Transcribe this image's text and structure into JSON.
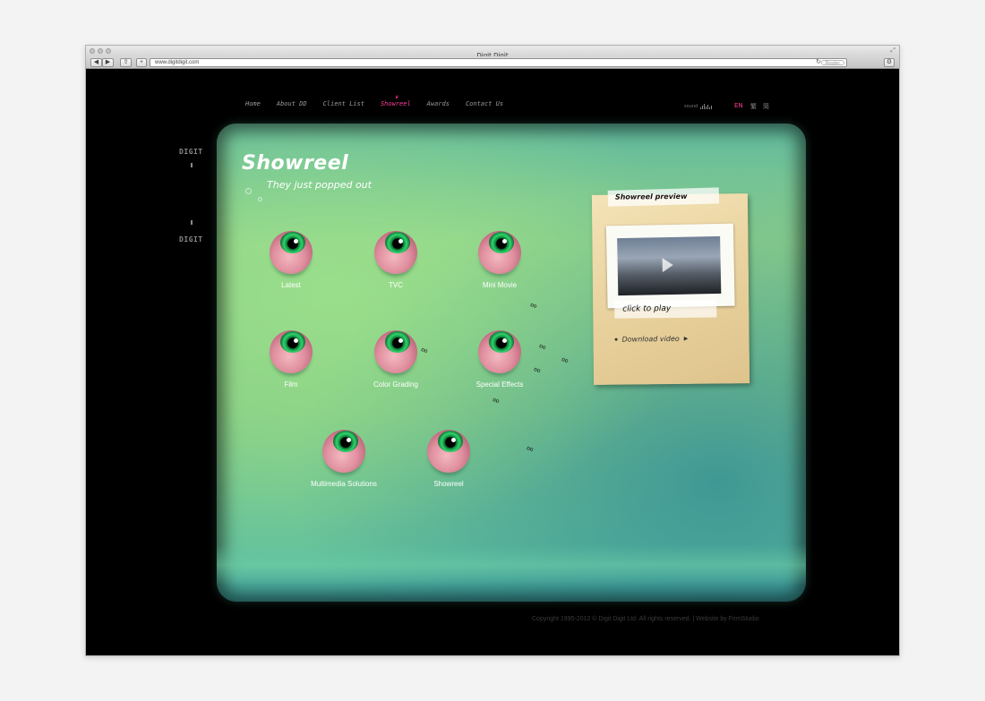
{
  "browser": {
    "title": "Digit Digit",
    "url": "www.digitdigit.com",
    "reader_label": "Reader"
  },
  "nav": {
    "items": [
      {
        "label": "Home",
        "active": false
      },
      {
        "label": "About DD",
        "active": false
      },
      {
        "label": "Client List",
        "active": false
      },
      {
        "label": "Showreel",
        "active": true
      },
      {
        "label": "Awards",
        "active": false
      },
      {
        "label": "Contact Us",
        "active": false
      }
    ],
    "sound_label": "sound",
    "languages": [
      {
        "label": "EN",
        "active": true
      },
      {
        "label": "繁",
        "active": false
      },
      {
        "label": "简",
        "active": false
      }
    ]
  },
  "side": {
    "top": "DIGIT",
    "bottom": "DIGIT"
  },
  "section": {
    "title": "Showreel",
    "subtitle": "They just popped out"
  },
  "categories": [
    {
      "label": "Latest"
    },
    {
      "label": "TVC"
    },
    {
      "label": "Mini Movie"
    },
    {
      "label": "Film"
    },
    {
      "label": "Color Grading"
    },
    {
      "label": "Special Effects"
    },
    {
      "label": "Multimedia Solutions"
    },
    {
      "label": "Showreel"
    }
  ],
  "preview": {
    "title": "Showreel preview",
    "click_label": "click to play",
    "download_label": "Download video"
  },
  "footer": {
    "copyright": "Copyright 1995-2012 © Digit Digit Ltd. All rights reserved. | Website by FirmStudio"
  },
  "colors": {
    "accent": "#ff3c9c",
    "screen_green": "#8fd18a",
    "card": "#e9d29e"
  }
}
